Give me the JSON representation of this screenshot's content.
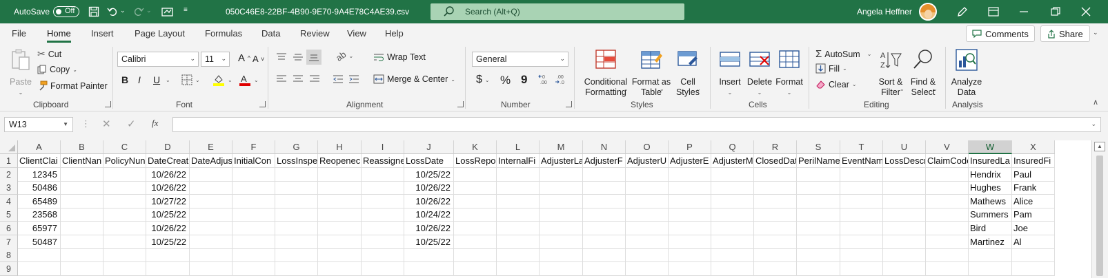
{
  "titlebar": {
    "autosave_label": "AutoSave",
    "autosave_state": "Off",
    "filename": "050C46E8-22BF-4B90-9E70-9A4E78C4AE39.csv",
    "search_placeholder": "Search (Alt+Q)",
    "user_name": "Angela Heffner"
  },
  "menu": {
    "tabs": [
      "File",
      "Home",
      "Insert",
      "Page Layout",
      "Formulas",
      "Data",
      "Review",
      "View",
      "Help"
    ],
    "active": "Home",
    "comments_label": "Comments",
    "share_label": "Share"
  },
  "ribbon": {
    "clipboard": {
      "label": "Clipboard",
      "paste": "Paste",
      "cut": "Cut",
      "copy": "Copy",
      "format_painter": "Format Painter"
    },
    "font": {
      "label": "Font",
      "font_name": "Calibri",
      "font_size": "11",
      "bold": "B",
      "italic": "I",
      "underline": "U"
    },
    "alignment": {
      "label": "Alignment",
      "wrap_text": "Wrap Text",
      "merge_center": "Merge & Center"
    },
    "number": {
      "label": "Number",
      "format": "General",
      "currency": "$",
      "percent": "%",
      "comma": "9"
    },
    "styles": {
      "label": "Styles",
      "conditional_1": "Conditional",
      "conditional_2": "Formatting",
      "format_table_1": "Format as",
      "format_table_2": "Table",
      "cell_styles_1": "Cell",
      "cell_styles_2": "Styles"
    },
    "cells": {
      "label": "Cells",
      "insert": "Insert",
      "delete": "Delete",
      "format": "Format"
    },
    "editing": {
      "label": "Editing",
      "autosum": "AutoSum",
      "fill": "Fill",
      "clear": "Clear",
      "sort_1": "Sort &",
      "sort_2": "Filter",
      "find_1": "Find &",
      "find_2": "Select"
    },
    "analysis": {
      "label": "Analysis",
      "analyze_1": "Analyze",
      "analyze_2": "Data"
    }
  },
  "formula_bar": {
    "name_box": "W13",
    "fx": "fx",
    "formula": ""
  },
  "sheet": {
    "columns": [
      "A",
      "B",
      "C",
      "D",
      "E",
      "F",
      "G",
      "H",
      "I",
      "J",
      "K",
      "L",
      "M",
      "N",
      "O",
      "P",
      "Q",
      "R",
      "S",
      "T",
      "U",
      "V",
      "W",
      "X"
    ],
    "selected_column": "W",
    "row_numbers": [
      "1",
      "2",
      "3",
      "4",
      "5",
      "6",
      "7",
      "8",
      "9"
    ],
    "rows": [
      [
        "ClientClai",
        "ClientNan",
        "PolicyNun",
        "DateCreat",
        "DateAdjus",
        "InitialCon",
        "LossInspe",
        "Reopenec",
        "Reassigne",
        "LossDate",
        "LossRepor",
        "InternalFi",
        "AdjusterLa",
        "AdjusterF",
        "AdjusterU",
        "AdjusterE",
        "AdjusterM",
        "ClosedDat",
        "PerilName",
        "EventNam",
        "LossDescr",
        "ClaimCode",
        "InsuredLa",
        "InsuredFi"
      ],
      [
        "12345",
        "",
        "",
        "10/26/22",
        "",
        "",
        "",
        "",
        "",
        "10/25/22",
        "",
        "",
        "",
        "",
        "",
        "",
        "",
        "",
        "",
        "",
        "",
        "",
        "Hendrix",
        "Paul"
      ],
      [
        "50486",
        "",
        "",
        "10/26/22",
        "",
        "",
        "",
        "",
        "",
        "10/26/22",
        "",
        "",
        "",
        "",
        "",
        "",
        "",
        "",
        "",
        "",
        "",
        "",
        "Hughes",
        "Frank"
      ],
      [
        "65489",
        "",
        "",
        "10/27/22",
        "",
        "",
        "",
        "",
        "",
        "10/26/22",
        "",
        "",
        "",
        "",
        "",
        "",
        "",
        "",
        "",
        "",
        "",
        "",
        "Mathews",
        "Alice"
      ],
      [
        "23568",
        "",
        "",
        "10/25/22",
        "",
        "",
        "",
        "",
        "",
        "10/24/22",
        "",
        "",
        "",
        "",
        "",
        "",
        "",
        "",
        "",
        "",
        "",
        "",
        "Summers",
        "Pam"
      ],
      [
        "65977",
        "",
        "",
        "10/26/22",
        "",
        "",
        "",
        "",
        "",
        "10/26/22",
        "",
        "",
        "",
        "",
        "",
        "",
        "",
        "",
        "",
        "",
        "",
        "",
        "Bird",
        "Joe"
      ],
      [
        "50487",
        "",
        "",
        "10/25/22",
        "",
        "",
        "",
        "",
        "",
        "10/25/22",
        "",
        "",
        "",
        "",
        "",
        "",
        "",
        "",
        "",
        "",
        "",
        "",
        "Martinez",
        "Al"
      ],
      [
        "",
        "",
        "",
        "",
        "",
        "",
        "",
        "",
        "",
        "",
        "",
        "",
        "",
        "",
        "",
        "",
        "",
        "",
        "",
        "",
        "",
        "",
        "",
        ""
      ],
      [
        "",
        "",
        "",
        "",
        "",
        "",
        "",
        "",
        "",
        "",
        "",
        "",
        "",
        "",
        "",
        "",
        "",
        "",
        "",
        "",
        "",
        "",
        "",
        ""
      ]
    ]
  },
  "colors": {
    "accent": "#217346",
    "search_bg": "#a9d3b4"
  }
}
